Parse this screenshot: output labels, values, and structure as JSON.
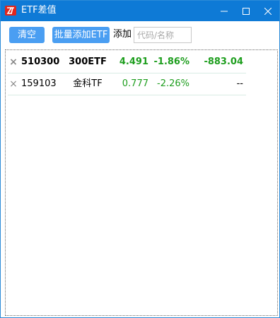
{
  "window": {
    "title": "ETF差值",
    "controls": {
      "minimize_glyph": "─",
      "maximize_glyph": "☐",
      "close_glyph": "✕"
    },
    "title_bar_color": "#0e7ad6"
  },
  "toolbar": {
    "clear_label": "清空",
    "batch_add_label": "批量添加ETF",
    "add_label": "添加",
    "code_input": {
      "value": "",
      "placeholder": "代码/名称"
    },
    "button_color": "#4a9ef2"
  },
  "rows": [
    {
      "remove_glyph": "×",
      "code": "510300",
      "name": "300ETF",
      "price": "4.491",
      "change_pct": "-1.86%",
      "diff": "-883.04",
      "bold": true
    },
    {
      "remove_glyph": "×",
      "code": "159103",
      "name": "金科TF",
      "price": "0.777",
      "change_pct": "-2.26%",
      "diff": "--",
      "bold": false
    }
  ],
  "colors": {
    "down": "#1e9e1e",
    "neutral": "#000000"
  }
}
